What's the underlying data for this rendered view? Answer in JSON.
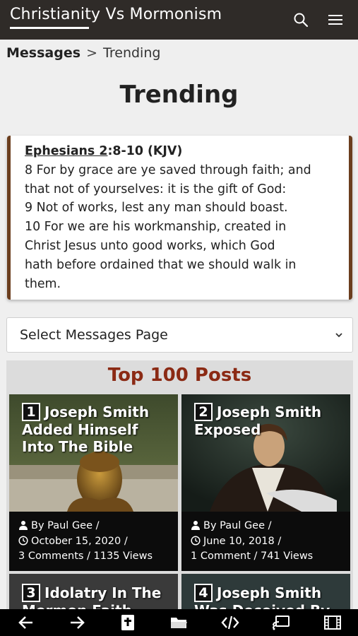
{
  "header": {
    "site_title": "Christianity Vs Mormonism",
    "search_icon": "search-icon",
    "menu_icon": "hamburger-menu-icon"
  },
  "breadcrumb": {
    "parent": "Messages",
    "separator": ">",
    "current": "Trending"
  },
  "page_title": "Trending",
  "verse": {
    "ref_book": "Ephesians 2",
    "ref_rest": ":8-10 (KJV)",
    "lines": [
      "8 For by grace are ye saved through faith; and",
      "that not of yourselves: it is the gift of God:",
      "9 Not of works, lest any man should boast.",
      "10 For we are his workmanship, created in",
      "Christ Jesus unto good works, which God",
      "hath before ordained that we should walk in",
      "them."
    ]
  },
  "select": {
    "label": "Select Messages Page"
  },
  "posts": {
    "heading": "Top 100 Posts",
    "items": [
      {
        "number": "1",
        "title": "Joseph Smith Added Himself Into The Bible",
        "author": "By Paul Gee /",
        "date": "October 15, 2020 /",
        "stats": "3 Comments / 1135 Views"
      },
      {
        "number": "2",
        "title": "Joseph Smith Exposed",
        "author": "By Paul Gee /",
        "date": "June 10, 2018 /",
        "stats": "1 Comment / 741 Views"
      },
      {
        "number": "3",
        "title": "Idolatry In The Mormon Faith",
        "author": "",
        "date": "",
        "stats": ""
      },
      {
        "number": "4",
        "title": "Joseph Smith Was Deceived By",
        "author": "",
        "date": "",
        "stats": ""
      }
    ]
  },
  "bottom_nav": {
    "icons": [
      "arrow-left-icon",
      "arrow-right-icon",
      "bible-icon",
      "folder-icon",
      "code-icon",
      "cast-icon",
      "film-icon"
    ]
  },
  "colors": {
    "topbar": "#2f2b28",
    "heading_red": "#8b2a14",
    "verse_border": "#6b3e1e"
  }
}
